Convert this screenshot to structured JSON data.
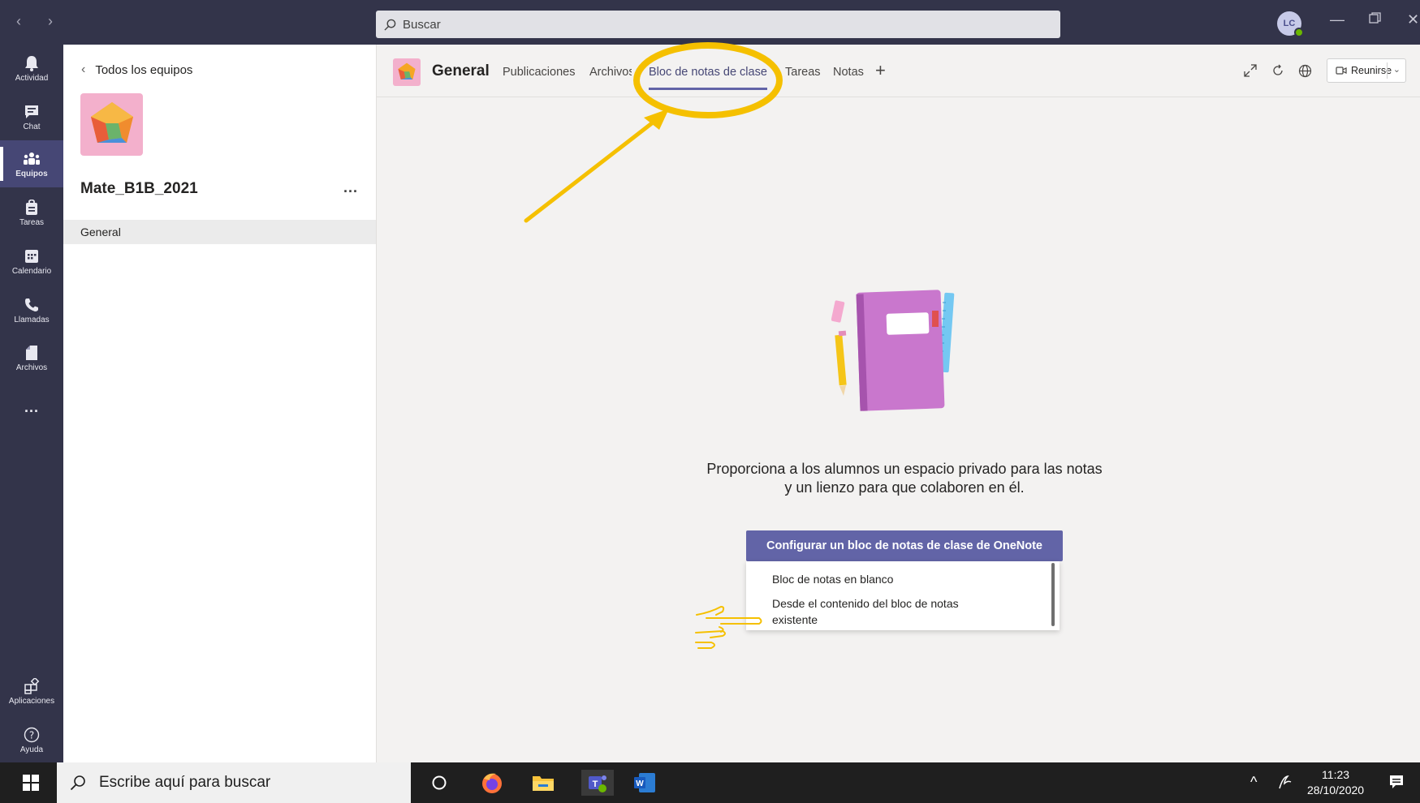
{
  "titlebar": {
    "search_placeholder": "Buscar",
    "avatar_initials": "LC"
  },
  "rail": {
    "items": [
      {
        "label": "Actividad",
        "icon": "bell-icon"
      },
      {
        "label": "Chat",
        "icon": "chat-icon"
      },
      {
        "label": "Equipos",
        "icon": "teams-icon",
        "active": true
      },
      {
        "label": "Tareas",
        "icon": "assignments-icon"
      },
      {
        "label": "Calendario",
        "icon": "calendar-icon"
      },
      {
        "label": "Llamadas",
        "icon": "phone-icon"
      },
      {
        "label": "Archivos",
        "icon": "files-icon"
      }
    ],
    "more": "...",
    "bottom": [
      {
        "label": "Aplicaciones",
        "icon": "apps-icon"
      },
      {
        "label": "Ayuda",
        "icon": "help-icon"
      }
    ]
  },
  "panel": {
    "back_label": "Todos los equipos",
    "team_name": "Mate_B1B_2021",
    "more": "...",
    "channels": [
      "General"
    ]
  },
  "main": {
    "channel_title": "General",
    "tabs": [
      {
        "label": "Publicaciones"
      },
      {
        "label": "Archivos"
      },
      {
        "label": "Bloc de notas de clase",
        "active": true
      },
      {
        "label": "Tareas"
      },
      {
        "label": "Notas"
      }
    ],
    "tab_add": "+",
    "meet_label": "Reunirse",
    "promo_line1": "Proporciona a los alumnos un espacio privado para las notas",
    "promo_line2": "y un lienzo para que colaboren en él.",
    "cta_label": "Configurar un bloc de notas de clase de OneNote",
    "menu": [
      "Bloc de notas en blanco",
      "Desde el contenido del bloc de notas existente"
    ]
  },
  "taskbar": {
    "search_placeholder": "Escribe aquí para buscar",
    "time": "11:23",
    "date": "28/10/2020"
  },
  "colors": {
    "rail_bg": "#33344a",
    "accent": "#6264a7",
    "annotation": "#f5c000"
  }
}
